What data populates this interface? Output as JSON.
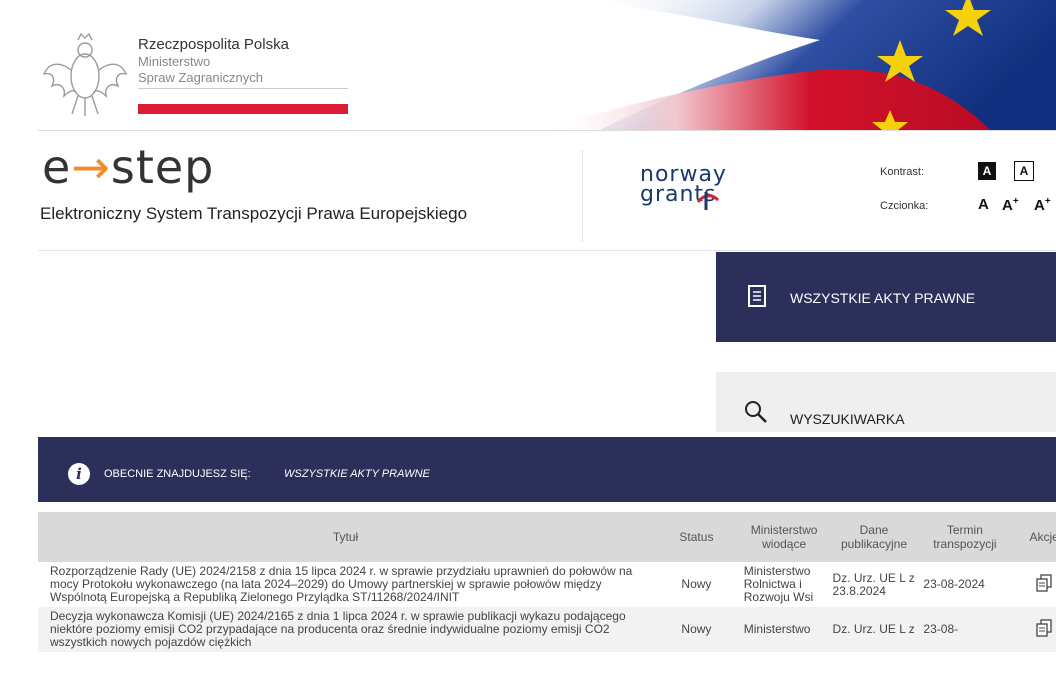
{
  "ministry": {
    "line1": "Rzeczpospolita Polska",
    "line2": "Ministerstwo",
    "line3": "Spraw Zagranicznych"
  },
  "logo": {
    "brand_left": "e",
    "brand_arrow": "→",
    "brand_right": "step",
    "subtitle": "Elektroniczny System Transpozycji Prawa Europejskiego",
    "partner_line1": "norway",
    "partner_line2": "grants"
  },
  "accessibility": {
    "contrast_label": "Kontrast:",
    "contrast_dark": "A",
    "contrast_light": "A",
    "font_label": "Czcionka:",
    "font_normal": "A",
    "font_large": "A",
    "font_large_sup": "+",
    "font_xlarge": "A",
    "font_xlarge_sup": "+"
  },
  "nav": {
    "all_acts": "WSZYSTKIE AKTY PRAWNE",
    "search": "WYSZUKIWARKA"
  },
  "breadcrumb": {
    "prefix": "OBECNIE ZNAJDUJESZ SIĘ:",
    "current": "WSZYSTKIE AKTY PRAWNE"
  },
  "table": {
    "headers": {
      "title": "Tytuł",
      "status": "Status",
      "ministry": "Ministerstwo wiodące",
      "publication": "Dane publikacyjne",
      "deadline": "Termin transpozycji",
      "actions": "Akcje"
    },
    "rows": [
      {
        "title": "Rozporządzenie Rady (UE) 2024/2158 z dnia 15 lipca 2024 r. w sprawie przydziału uprawnień do połowów na mocy Protokołu wykonawczego (na lata 2024–2029) do Umowy partnerskiej w sprawie połowów między Wspólnotą Europejską a Republiką Zielonego Przylądka ST/11268/2024/INIT",
        "status": "Nowy",
        "ministry": "Ministerstwo Rolnictwa i Rozwoju Wsi",
        "publication": "Dz. Urz. UE L z 23.8.2024",
        "deadline": "23-08-2024"
      },
      {
        "title": "Decyzja wykonawcza Komisji (UE) 2024/2165 z dnia 1 lipca 2024 r. w sprawie publikacji wykazu podającego niektóre poziomy emisji CO2 przypadające na producenta oraz średnie indywidualne poziomy emisji CO2 wszystkich nowych pojazdów ciężkich",
        "status": "Nowy",
        "ministry": "Ministerstwo",
        "publication": "Dz. Urz. UE L z",
        "deadline": "23-08-"
      }
    ]
  },
  "colors": {
    "navy": "#2d2f5b",
    "red": "#dc1e35",
    "orange": "#f28c28"
  }
}
